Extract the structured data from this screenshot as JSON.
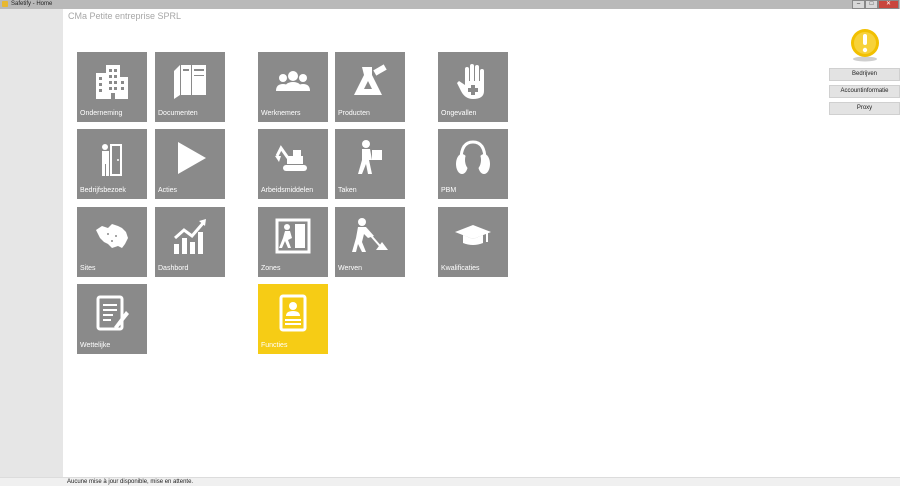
{
  "window": {
    "title": "Safetify - Home",
    "min": "–",
    "max": "□",
    "close": "✕"
  },
  "company_name": "CMa Petite entreprise SPRL",
  "tiles": [
    {
      "label": "Onderneming",
      "icon": "building-icon"
    },
    {
      "label": "Documenten",
      "icon": "books-icon"
    },
    {
      "label": "Werknemers",
      "icon": "people-icon"
    },
    {
      "label": "Producten",
      "icon": "flask-icon"
    },
    {
      "label": "Ongevallen",
      "icon": "hand-icon"
    },
    {
      "label": "Bedrijfsbezoek",
      "icon": "visitor-door-icon"
    },
    {
      "label": "Acties",
      "icon": "play-icon"
    },
    {
      "label": "Arbeidsmiddelen",
      "icon": "excavator-icon"
    },
    {
      "label": "Taken",
      "icon": "worker-carrying-icon"
    },
    {
      "label": "PBM",
      "icon": "ear-protection-icon"
    },
    {
      "label": "Sites",
      "icon": "map-icon"
    },
    {
      "label": "Dashbord",
      "icon": "bar-chart-icon"
    },
    {
      "label": "Zones",
      "icon": "exit-icon"
    },
    {
      "label": "Werven",
      "icon": "digging-worker-icon"
    },
    {
      "label": "Kwalificaties",
      "icon": "graduation-cap-icon"
    },
    {
      "label": "Wettelijke",
      "icon": "document-pen-icon"
    },
    {
      "label": "Functies",
      "icon": "id-badge-icon",
      "selected": true
    }
  ],
  "right_panel": {
    "warning_icon": "warning-icon",
    "buttons": [
      "Bedrijven",
      "Accountinformatie",
      "Proxy"
    ]
  },
  "status": "Aucune mise à jour disponible, mise en attente.",
  "colors": {
    "tile": "#8a8a8a",
    "tile_active": "#f6cc15",
    "sidebar": "#e6e6e6",
    "warning": "#f2c000"
  }
}
